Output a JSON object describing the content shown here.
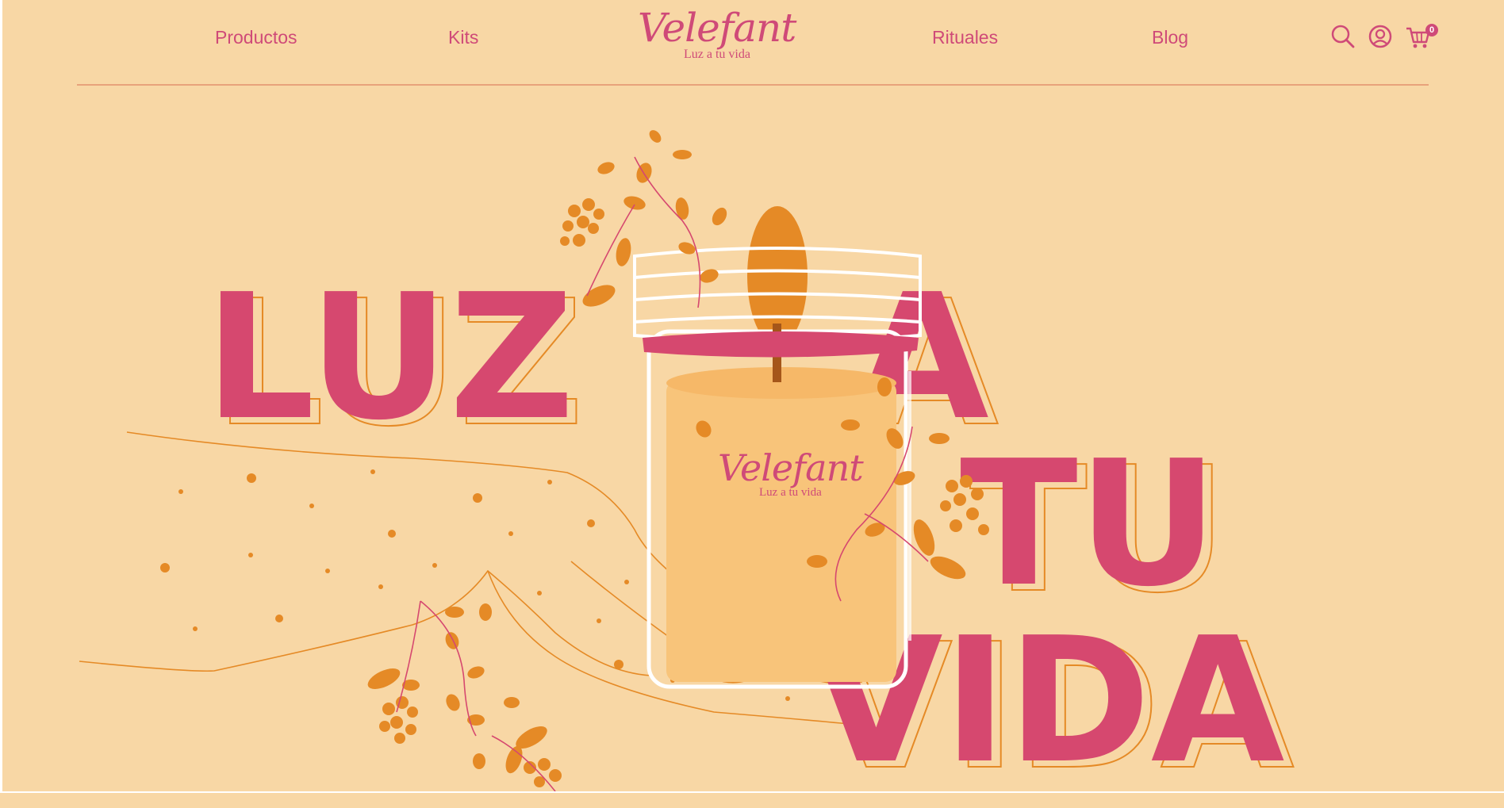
{
  "nav": {
    "left": [
      {
        "label": "Productos"
      },
      {
        "label": "Kits"
      }
    ],
    "right": [
      {
        "label": "Rituales"
      },
      {
        "label": "Blog"
      }
    ]
  },
  "logo": {
    "name": "Velefant",
    "tagline": "Luz a tu vida"
  },
  "icons": {
    "search": "search-icon",
    "account": "user-circle-icon",
    "cart": "cart-icon"
  },
  "cart": {
    "count": "0"
  },
  "hero": {
    "line1a": "LUZ",
    "line1b": "A",
    "line2": "TU",
    "line3": "VIDA",
    "candle_label": {
      "name": "Velefant",
      "tagline": "Luz a tu vida"
    }
  },
  "colors": {
    "background": "#f8d7a5",
    "brand_pink": "#d6486f",
    "accent_orange": "#e58a26",
    "candle_wax": "#f8c47a"
  }
}
